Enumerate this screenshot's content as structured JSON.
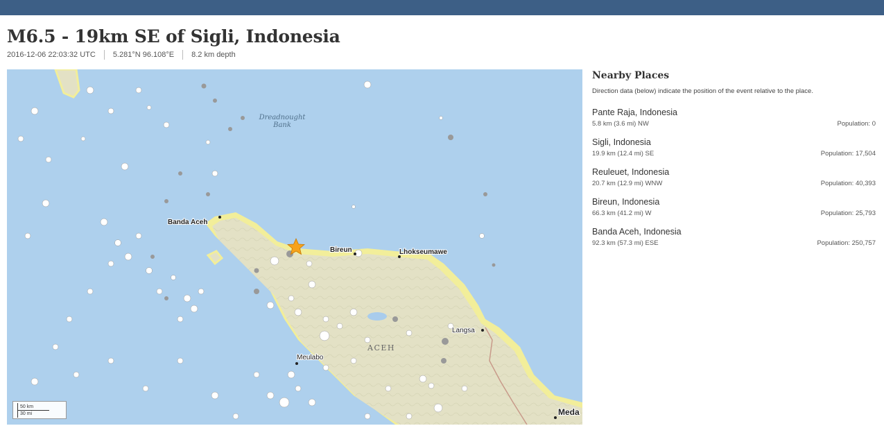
{
  "header": {
    "bar_color": "#3d5f86"
  },
  "event": {
    "title": "M6.5 - 19km SE of Sigli, Indonesia",
    "time": "2016-12-06 22:03:32 UTC",
    "coordinates": "5.281°N 96.108°E",
    "depth": "8.2 km depth"
  },
  "map": {
    "labels": {
      "dreadnought": "Dreadnought",
      "bank": "Bank",
      "banda_aceh": "Banda Aceh",
      "bireun": "Bireun",
      "lhokseumawe": "Lhokseumawe",
      "langsa": "Langsa",
      "aceh": "ACEH",
      "meulabo": "Meulabo",
      "medan": "Meda"
    },
    "scale": {
      "km": "50 km",
      "mi": "30 mi"
    },
    "colors": {
      "sea": "#a9ccec",
      "land": "#e3e1c5",
      "coast": "#f2ee9a",
      "epicenter": "#f7a21b"
    }
  },
  "nearby": {
    "title": "Nearby Places",
    "note": "Direction data (below) indicate the position of the event relative to the place.",
    "places": [
      {
        "name": "Pante Raja, Indonesia",
        "distance": "5.8 km (3.6 mi) NW",
        "population": "Population: 0"
      },
      {
        "name": "Sigli, Indonesia",
        "distance": "19.9 km (12.4 mi) SE",
        "population": "Population: 17,504"
      },
      {
        "name": "Reuleuet, Indonesia",
        "distance": "20.7 km (12.9 mi) WNW",
        "population": "Population: 40,393"
      },
      {
        "name": "Bireun, Indonesia",
        "distance": "66.3 km (41.2 mi) W",
        "population": "Population: 25,793"
      },
      {
        "name": "Banda Aceh, Indonesia",
        "distance": "92.3 km (57.3 mi) ESE",
        "population": "Population: 250,757"
      }
    ]
  }
}
